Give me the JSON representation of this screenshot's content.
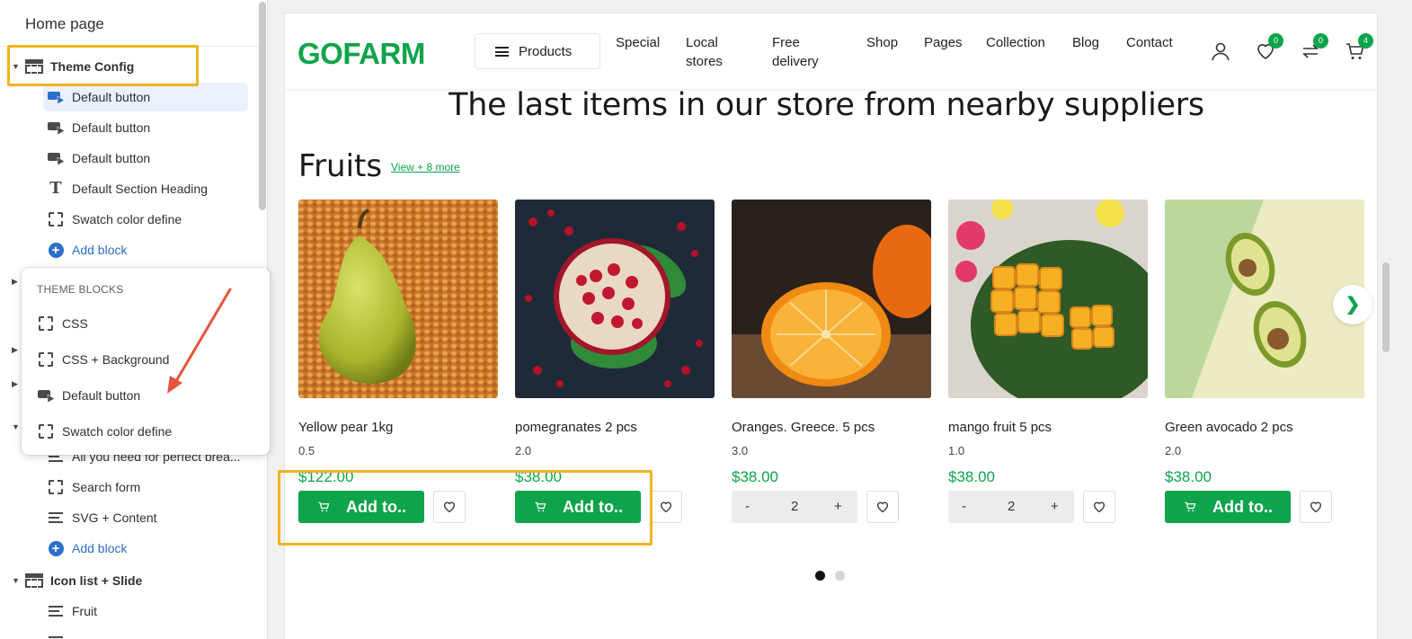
{
  "sidebar": {
    "title": "Home page",
    "theme_config": {
      "label": "Theme Config",
      "children": [
        {
          "label": "Default button",
          "icon": "button-icon",
          "selected": true
        },
        {
          "label": "Default button",
          "icon": "button-icon"
        },
        {
          "label": "Default button",
          "icon": "button-icon"
        },
        {
          "label": "Default Section Heading",
          "icon": "text-icon"
        },
        {
          "label": "Swatch color define",
          "icon": "block-icon"
        }
      ],
      "add_block": "Add block"
    },
    "other_children": [
      {
        "label": "All you need for perfect brea...",
        "icon": "lines-icon"
      },
      {
        "label": "Search form",
        "icon": "block-icon"
      },
      {
        "label": "SVG + Content",
        "icon": "lines-icon"
      }
    ],
    "add_block_2": "Add block",
    "icon_list_section": {
      "label": "Icon list + Slide",
      "children": [
        {
          "label": "Fruit",
          "icon": "lines-icon"
        }
      ]
    }
  },
  "popover": {
    "title": "THEME BLOCKS",
    "items": [
      {
        "label": "CSS",
        "icon": "block-icon"
      },
      {
        "label": "CSS + Background",
        "icon": "block-icon"
      },
      {
        "label": "Default button",
        "icon": "button-icon"
      },
      {
        "label": "Swatch color define",
        "icon": "block-icon"
      }
    ]
  },
  "store": {
    "logo": "GOFARM",
    "products_button": "Products",
    "nav": [
      "Special",
      "Local\nstores",
      "Free\ndelivery",
      "Shop",
      "Pages",
      "Collection",
      "Blog",
      "Contact"
    ],
    "badges": {
      "wishlist": "0",
      "compare": "0",
      "cart": "4"
    },
    "heading": "The last items in our store from nearby suppliers",
    "category": "Fruits",
    "view_more": "View + 8 more",
    "products": [
      {
        "name": "Yellow pear 1kg",
        "weight": "0.5",
        "price": "$122.00",
        "action": "add",
        "add_label": "Add to.."
      },
      {
        "name": "pomegranates 2 pcs",
        "weight": "2.0",
        "price": "$38.00",
        "action": "add",
        "add_label": "Add to.."
      },
      {
        "name": "Oranges. Greece. 5 pcs",
        "weight": "3.0",
        "price": "$38.00",
        "action": "qty",
        "qty": "2"
      },
      {
        "name": "mango fruit 5 pcs",
        "weight": "1.0",
        "price": "$38.00",
        "action": "qty",
        "qty": "2"
      },
      {
        "name": "Green avocado 2 pcs",
        "weight": "2.0",
        "price": "$38.00",
        "action": "add",
        "add_label": "Add to.."
      }
    ],
    "next_icon": "❯",
    "qty_minus": "-",
    "qty_plus": "+"
  },
  "colors": {
    "brand_green": "#0ea44b",
    "highlight_yellow": "#f0b421",
    "admin_blue": "#2c6ecb",
    "arrow_red": "#e8543e"
  }
}
